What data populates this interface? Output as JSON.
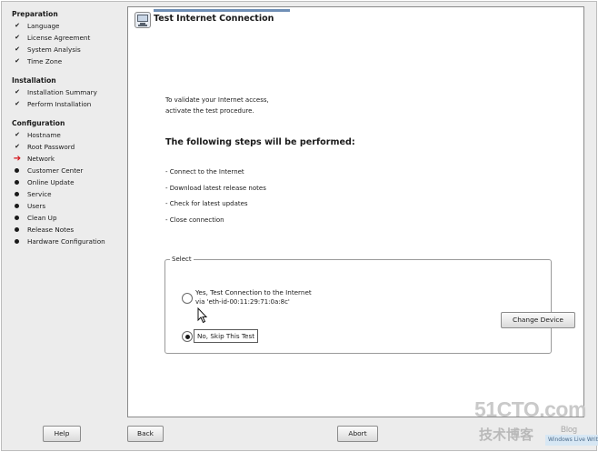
{
  "sidebar": {
    "sections": [
      {
        "title": "Preparation",
        "steps": [
          {
            "label": "Language",
            "status": "done"
          },
          {
            "label": "License Agreement",
            "status": "done"
          },
          {
            "label": "System Analysis",
            "status": "done"
          },
          {
            "label": "Time Zone",
            "status": "done"
          }
        ]
      },
      {
        "title": "Installation",
        "steps": [
          {
            "label": "Installation Summary",
            "status": "done"
          },
          {
            "label": "Perform Installation",
            "status": "done"
          }
        ]
      },
      {
        "title": "Configuration",
        "steps": [
          {
            "label": "Hostname",
            "status": "done"
          },
          {
            "label": "Root Password",
            "status": "done"
          },
          {
            "label": "Network",
            "status": "current"
          },
          {
            "label": "Customer Center",
            "status": "pending"
          },
          {
            "label": "Online Update",
            "status": "pending"
          },
          {
            "label": "Service",
            "status": "pending"
          },
          {
            "label": "Users",
            "status": "pending"
          },
          {
            "label": "Clean Up",
            "status": "pending"
          },
          {
            "label": "Release Notes",
            "status": "pending"
          },
          {
            "label": "Hardware Configuration",
            "status": "pending"
          }
        ]
      }
    ],
    "marks": {
      "done": "✔",
      "current": "➔",
      "pending": ""
    }
  },
  "header": {
    "title": "Test Internet Connection",
    "icon": "network-computer-icon"
  },
  "intro": {
    "line1": "To validate your Internet access,",
    "line2": "activate the test procedure."
  },
  "steps_heading": "The following steps will be performed:",
  "steps_list": [
    "- Connect to the Internet",
    "- Download latest release notes",
    "- Check for latest updates",
    "- Close connection"
  ],
  "select": {
    "legend": "Select",
    "option_yes": "Yes, Test Connection to the Internet",
    "option_yes_sub": "via 'eth-id-00:11:29:71:0a:8c'",
    "option_no": "No, Skip This Test",
    "selected": "no",
    "change_device": "Change Device"
  },
  "buttons": {
    "help": "Help",
    "back": "Back",
    "abort": "Abort"
  },
  "watermark": {
    "main": "51CTO.com",
    "sub": "技术博客",
    "blog": "Blog",
    "badge": "Windows Live Writer"
  },
  "colors": {
    "accent_arrow": "#d4141a",
    "header_bar": "#6f8fb6"
  }
}
